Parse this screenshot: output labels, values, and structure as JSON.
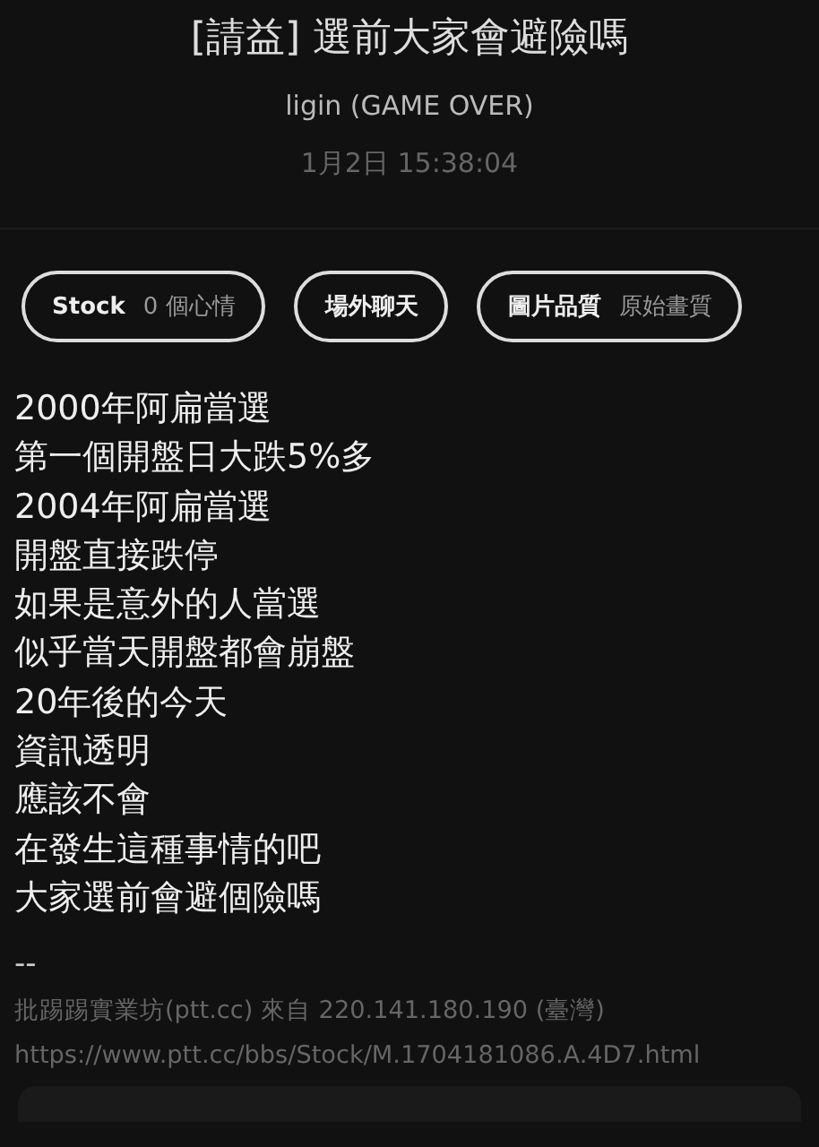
{
  "post": {
    "title": "[請益] 選前大家會避險嗎",
    "author": "ligin (GAME OVER)",
    "time": "1月2日 15:38:04"
  },
  "chips": [
    {
      "label": "Stock",
      "value": "0 個心情"
    },
    {
      "label": "場外聊天"
    },
    {
      "label": "圖片品質",
      "value": "原始畫質"
    }
  ],
  "body": [
    "2000年阿扁當選",
    "第一個開盤日大跌5%多",
    "2004年阿扁當選",
    "開盤直接跌停",
    "如果是意外的人當選",
    "似乎當天開盤都會崩盤",
    "20年後的今天",
    "資訊透明",
    "應該不會",
    "在發生這種事情的吧",
    "大家選前會避個險嗎"
  ],
  "signature": "--",
  "footer": [
    "批踢踢實業坊(ptt.cc) 來自 220.141.180.190 (臺灣)",
    "https://www.ptt.cc/bbs/Stock/M.1704181086.A.4D7.html"
  ]
}
